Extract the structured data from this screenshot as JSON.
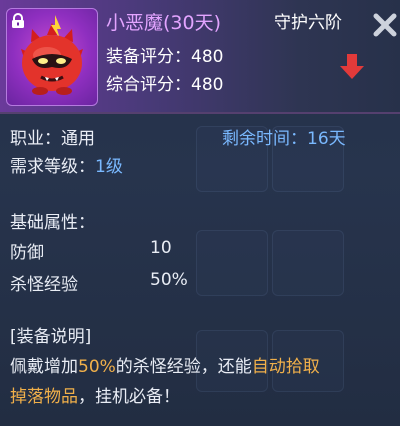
{
  "item": {
    "name": "小恶魔(30天)",
    "rank": "守护六阶",
    "equip_score_label": "装备评分：",
    "equip_score": "480",
    "total_score_label": "综合评分：",
    "total_score": "480",
    "icon": "red-demon-pet",
    "locked": true,
    "score_trend_icon": "red-down-arrow"
  },
  "info": {
    "class_label": "职业：",
    "class_value": "通用",
    "time_label": "剩余时间：",
    "time_value": "16天",
    "level_label": "需求等级：",
    "level_value": "1级"
  },
  "attributes": {
    "heading": "基础属性：",
    "rows": [
      {
        "name": "防御",
        "value": "10"
      },
      {
        "name": "杀怪经验",
        "value": "50%"
      }
    ]
  },
  "description": {
    "heading": "[装备说明]",
    "part1": "佩戴增加",
    "highlight1": "50%",
    "part2": "的杀怪经验，还能",
    "highlight2": "自动拾取",
    "highlight3": "掉落物品",
    "part3": "，挂机必备！"
  },
  "colors": {
    "name": "#e3a4ff",
    "accent_blue": "#7ab9ff",
    "highlight_gold": "#f1b04a",
    "down_arrow": "#e23a3a"
  }
}
